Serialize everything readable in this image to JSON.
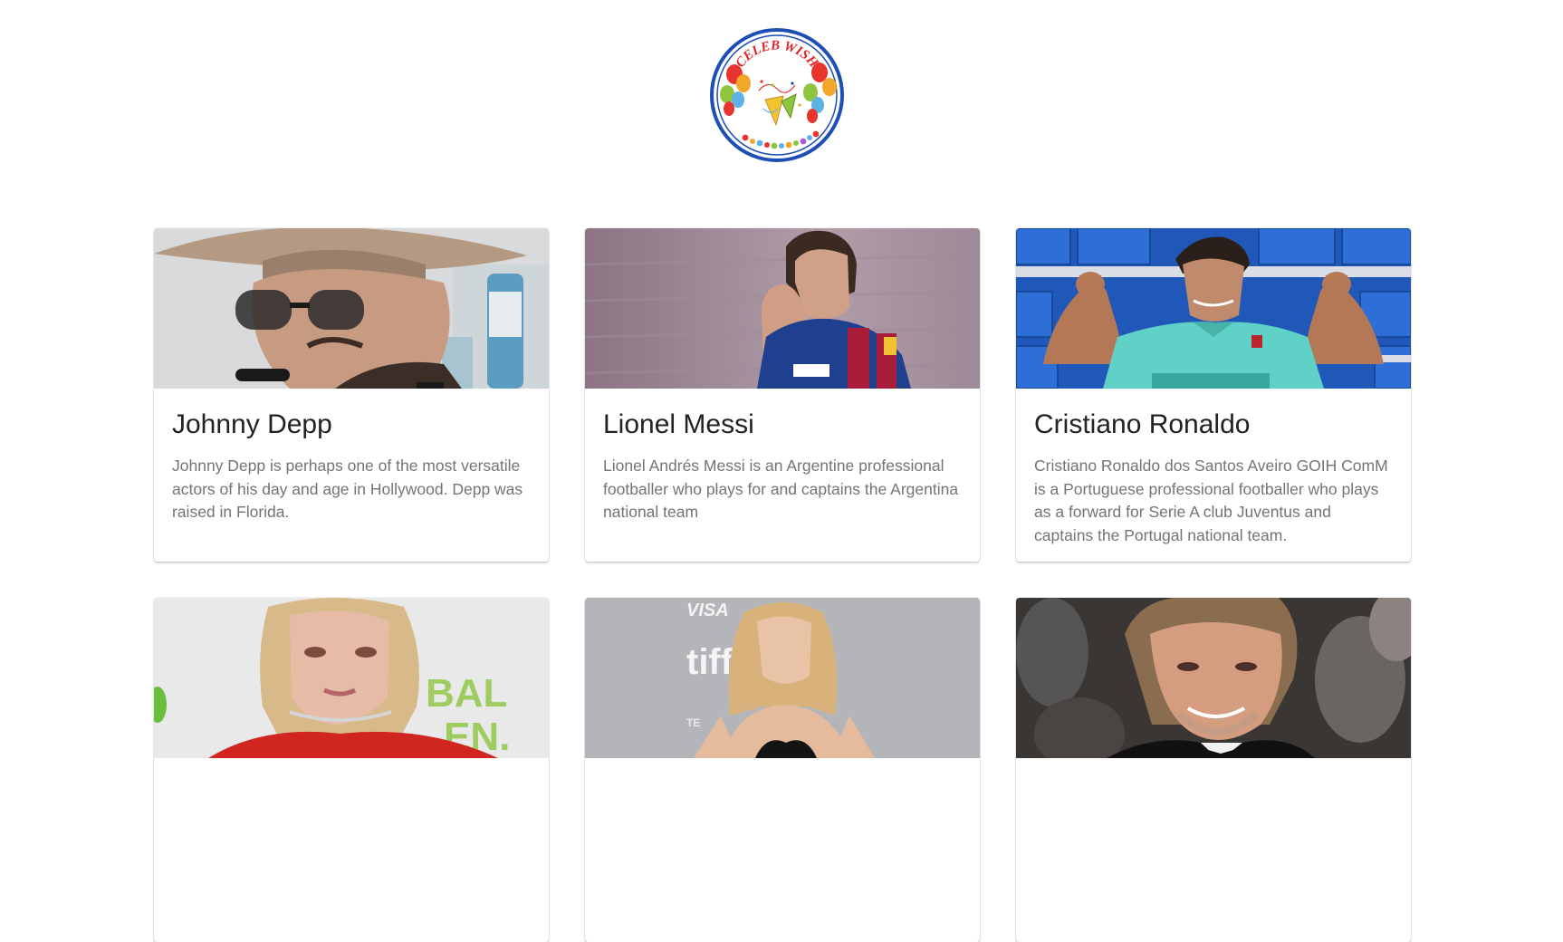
{
  "logo": {
    "text": "CELEB WISH",
    "icon": "celebration-balloons-icon",
    "colors": {
      "ring": "#1d4fb5",
      "text": "#e0262d"
    }
  },
  "cards": [
    {
      "name": "Johnny Depp",
      "description": "Johnny Depp is perhaps one of the most versatile actors of his day and age in Hollywood. Depp was raised in Florida.",
      "photo": "johnny-depp-photo"
    },
    {
      "name": "Lionel Messi",
      "description": "Lionel Andrés Messi is an Argentine professional footballer who plays for and captains the Argentina national team",
      "photo": "lionel-messi-photo"
    },
    {
      "name": "Cristiano Ronaldo",
      "description": "Cristiano Ronaldo dos Santos Aveiro GOIH ComM is a Portuguese professional footballer who plays as a forward for Serie A club Juventus and captains the Portugal national team.",
      "photo": "cristiano-ronaldo-photo"
    },
    {
      "photo": "selena-gomez-photo"
    },
    {
      "photo": "jennifer-lawrence-photo"
    },
    {
      "photo": "brad-pitt-photo"
    }
  ]
}
